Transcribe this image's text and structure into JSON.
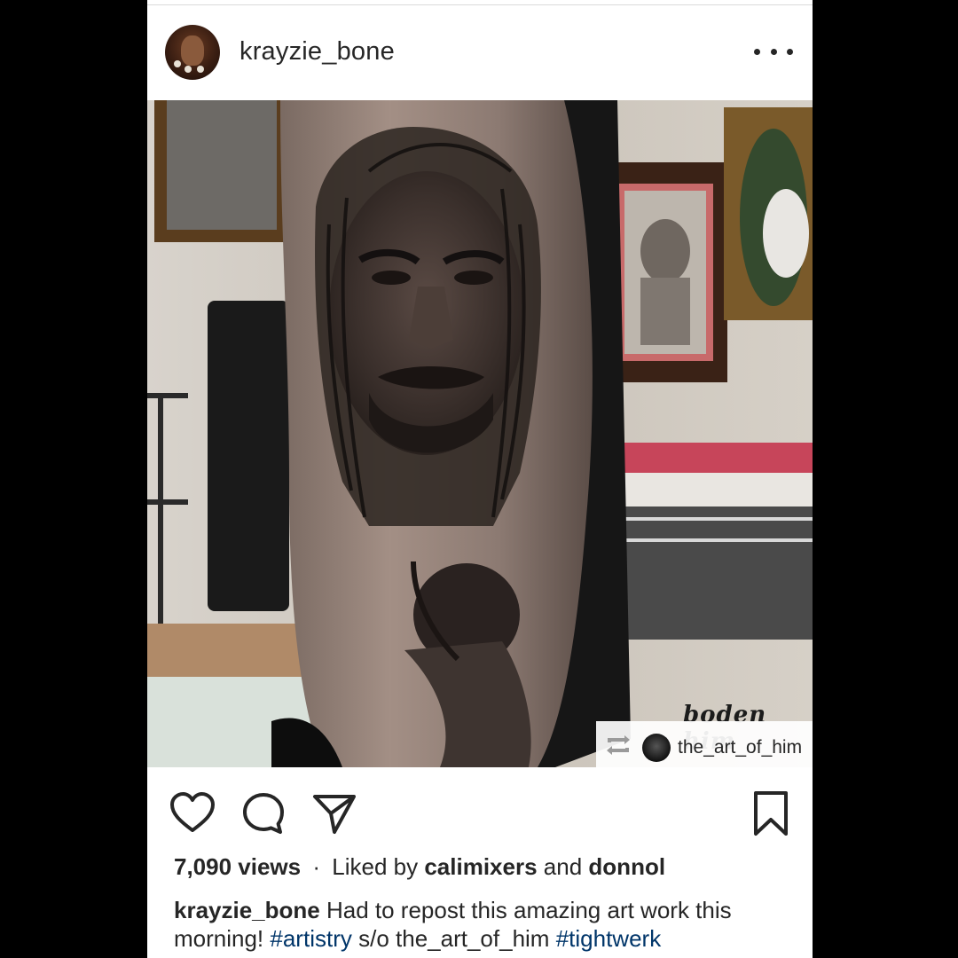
{
  "post": {
    "username": "krayzie_bone",
    "more_label": "More options"
  },
  "media": {
    "description_alt": "Tattoo portrait on a leg",
    "signature": "boden him",
    "repost_badge_name": "the_art_of_him"
  },
  "actions": {
    "like_icon": "heart-icon",
    "comment_icon": "comment-icon",
    "share_icon": "paper-plane-icon",
    "save_icon": "bookmark-icon"
  },
  "stats": {
    "views": "7,090 views",
    "separator": "·",
    "liked_by_prefix": "Liked by",
    "liked_user": "calimixers",
    "liked_and": "and",
    "liked_other": "donnol"
  },
  "caption": {
    "author": "krayzie_bone",
    "text1": "Had to repost this amazing art work this morning!",
    "hashtag1": "#artistry",
    "text2": "s/o",
    "mention": "the_art_of_him",
    "hashtag2": "#tightwerk"
  },
  "colors": {
    "text": "#262626",
    "link": "#003569",
    "frame": "#000000"
  }
}
